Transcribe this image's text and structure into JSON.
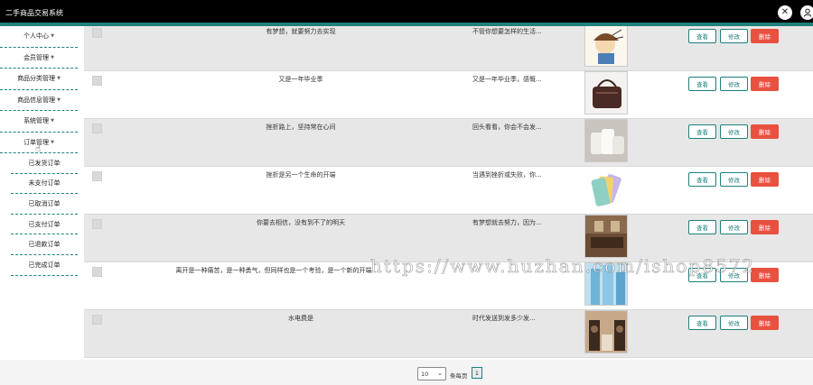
{
  "app": {
    "title": "二手商品交易系统"
  },
  "header": {
    "close_icon": "close-icon",
    "user_icon": "user-icon"
  },
  "sidebar": {
    "items": [
      {
        "label": "个人中心"
      },
      {
        "label": "会员管理"
      },
      {
        "label": "商品分类管理"
      },
      {
        "label": "商品信息管理"
      },
      {
        "label": "系统管理"
      },
      {
        "label": "订单管理"
      }
    ],
    "order_submenu": [
      {
        "label": "已发货订单"
      },
      {
        "label": "未支付订单"
      },
      {
        "label": "已取消订单"
      },
      {
        "label": "已支付订单"
      },
      {
        "label": "已退款订单"
      },
      {
        "label": "已完成订单"
      }
    ]
  },
  "table": {
    "buttons": {
      "view": "查看",
      "edit": "修改",
      "delete": "删除"
    },
    "rows": [
      {
        "title": "有梦想，就要努力去实现",
        "desc": "不管你想要怎样的生活..."
      },
      {
        "title": "又是一年毕业季",
        "desc": "又是一年毕业季，感慨..."
      },
      {
        "title": "挫折路上，坚持常在心间",
        "desc": "回头看看，你会不会发..."
      },
      {
        "title": "挫折是另一个生命的开端",
        "desc": "当遇到挫折或失败，你..."
      },
      {
        "title": "你要去相信，没有到不了的明天",
        "desc": "有梦想就去努力，因为..."
      },
      {
        "title": "离开是一种痛苦，是一种勇气，但同样也是一个考验，是一个新的开端",
        "desc": "…"
      },
      {
        "title": "水电费是",
        "desc": "时代发送到发多少发..."
      }
    ]
  },
  "pagination": {
    "page_size": "10",
    "per_page_label": "条每页",
    "current_page": "1"
  },
  "watermark": "https://www.huzhan.com/ishop8572",
  "colors": {
    "accent": "#1f7f7b",
    "delete": "#e8513f",
    "topbar": "#000000"
  }
}
